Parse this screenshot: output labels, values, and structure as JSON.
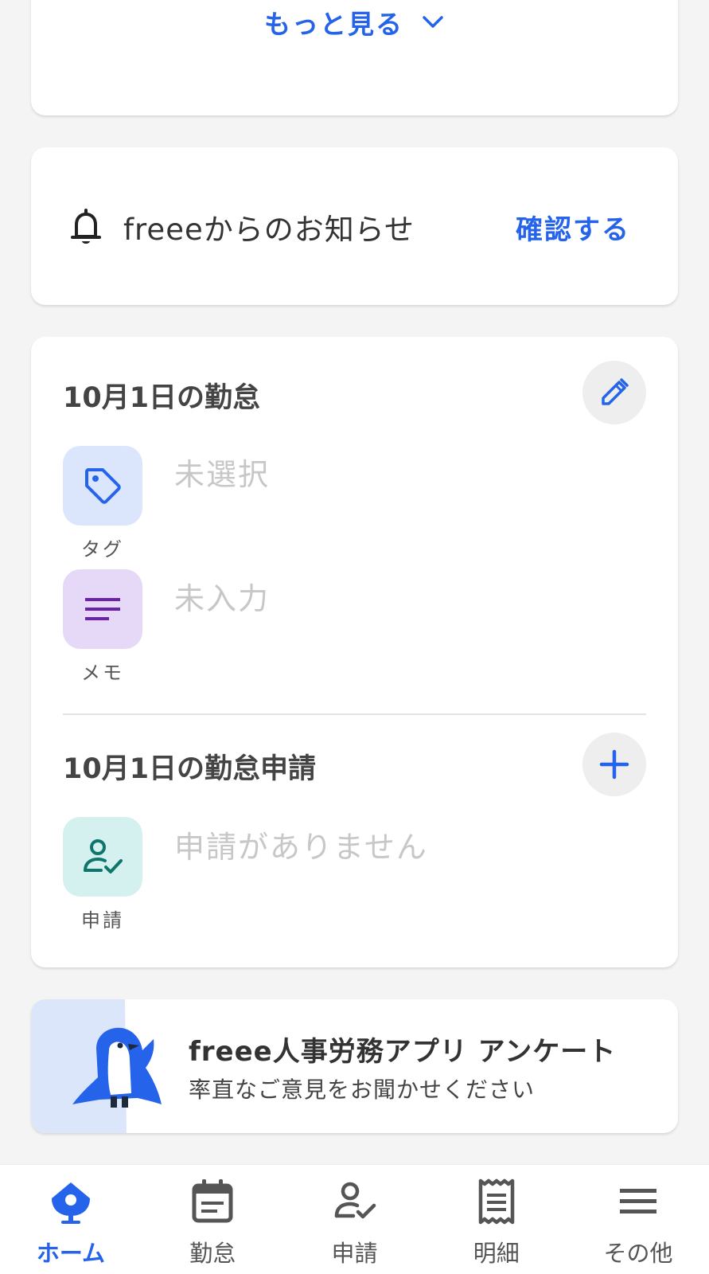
{
  "more": {
    "label": "もっと見る"
  },
  "notice": {
    "title": "freeeからのお知らせ",
    "action": "確認する"
  },
  "attendance": {
    "title": "10月1日の勤怠",
    "tag": {
      "caption": "タグ",
      "value": "未選択"
    },
    "memo": {
      "caption": "メモ",
      "value": "未入力"
    }
  },
  "requests": {
    "title": "10月1日の勤怠申請",
    "item": {
      "caption": "申請",
      "value": "申請がありません"
    }
  },
  "survey": {
    "title": "freee人事労務アプリ アンケート",
    "subtitle": "率直なご意見をお聞かせください"
  },
  "nav": {
    "home": "ホーム",
    "attendance": "勤怠",
    "request": "申請",
    "payslip": "明細",
    "other": "その他"
  },
  "colors": {
    "accent": "#2563eb",
    "tag_tile": "#dbe6fd",
    "memo_tile": "#e6d9f8",
    "request_tile": "#d4f0ef"
  }
}
